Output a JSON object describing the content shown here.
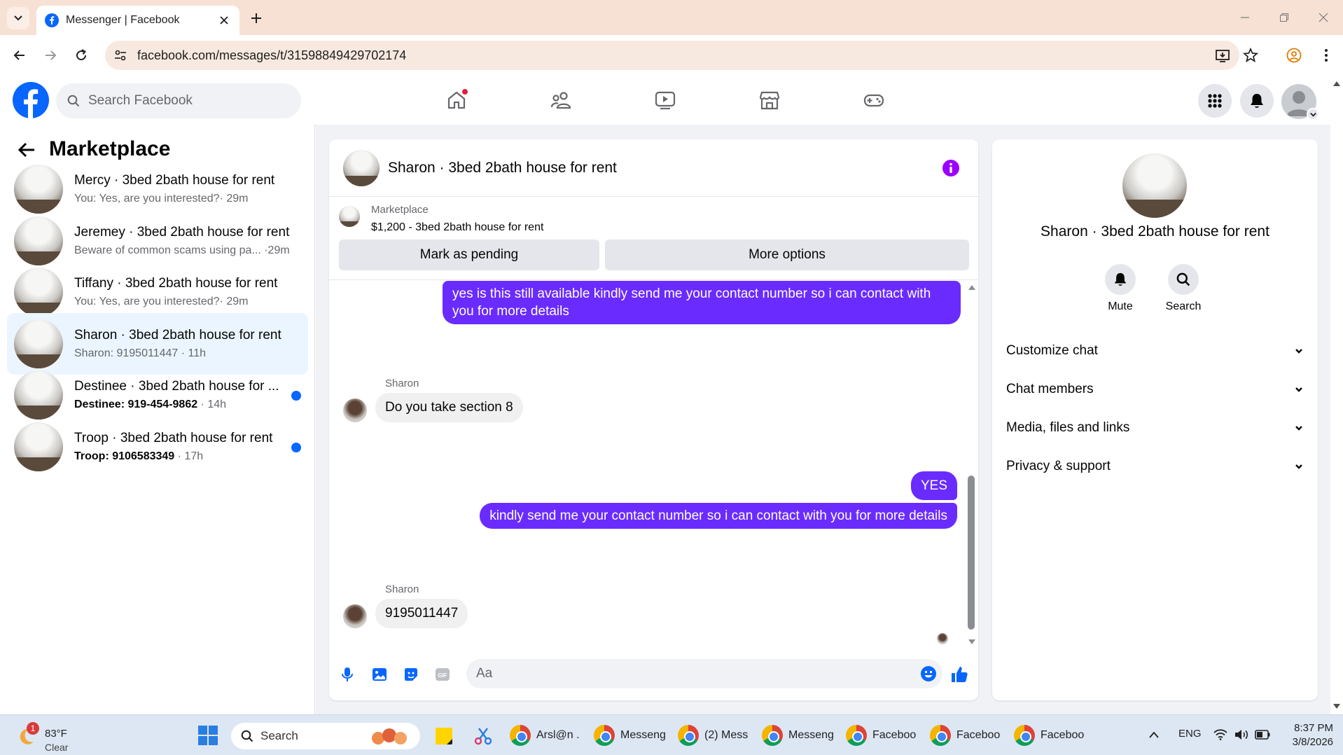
{
  "browser": {
    "tab_title": "Messenger | Facebook",
    "url": "facebook.com/messages/t/31598849429702174"
  },
  "fb_header": {
    "search_placeholder": "Search Facebook"
  },
  "left_panel": {
    "title": "Marketplace",
    "conversations": [
      {
        "name": "Mercy · 3bed 2bath house for rent",
        "preview": "You: Yes, are you interested?",
        "time": "· 29m",
        "unread": false,
        "active": false
      },
      {
        "name": "Jeremey · 3bed 2bath house for rent",
        "preview": "Beware of common scams using pa...",
        "time": " ·29m",
        "unread": false,
        "active": false
      },
      {
        "name": "Tiffany · 3bed 2bath house for rent",
        "preview": "You: Yes, are you interested?",
        "time": "· 29m",
        "unread": false,
        "active": false
      },
      {
        "name": "Sharon · 3bed 2bath house for rent",
        "preview": "Sharon: 9195011447",
        "time": " · 11h",
        "unread": false,
        "active": true
      },
      {
        "name": "Destinee · 3bed 2bath house for ...",
        "preview": "Destinee: 919-454-9862",
        "time": " · 14h",
        "unread": true,
        "active": false
      },
      {
        "name": "Troop · 3bed 2bath house for rent",
        "preview": "Troop: 9106583349",
        "time": " · 17h",
        "unread": true,
        "active": false
      }
    ]
  },
  "chat": {
    "title": "Sharon · 3bed 2bath house for rent",
    "marketplace_label": "Marketplace",
    "listing": "$1,200 - 3bed 2bath house for rent",
    "btn_pending": "Mark as pending",
    "btn_more": "More options",
    "messages": [
      {
        "from": "me",
        "text": "yes is this still available kindly send me your contact number so i can contact with you for more details"
      },
      {
        "from": "Sharon",
        "sender": "Sharon",
        "text": "Do you take section 8"
      },
      {
        "from": "me",
        "text": "YES"
      },
      {
        "from": "me",
        "text": "kindly send me your contact number so i can contact with you for more details"
      },
      {
        "from": "Sharon",
        "sender": "Sharon",
        "text": "9195011447"
      }
    ],
    "composer_placeholder": "Aa"
  },
  "right_panel": {
    "name": "Sharon · 3bed 2bath house for rent",
    "mute_label": "Mute",
    "search_label": "Search",
    "sections": [
      "Customize chat",
      "Chat members",
      "Media, files and links",
      "Privacy & support"
    ]
  },
  "taskbar": {
    "weather_temp": "83°F",
    "weather_cond": "Clear",
    "weather_badge": "1",
    "search": "Search",
    "apps": [
      "Arsl@n .",
      "Messeng",
      "(2) Mess",
      "Messeng",
      "Faceboo",
      "Faceboo",
      "Faceboo"
    ],
    "lang": "ENG",
    "time": "8:37 PM",
    "date": "3/8/2026"
  },
  "colors": {
    "brand": "#0866ff",
    "outgoing_bubble": "#6a2bff",
    "info": "#9b00ff"
  }
}
